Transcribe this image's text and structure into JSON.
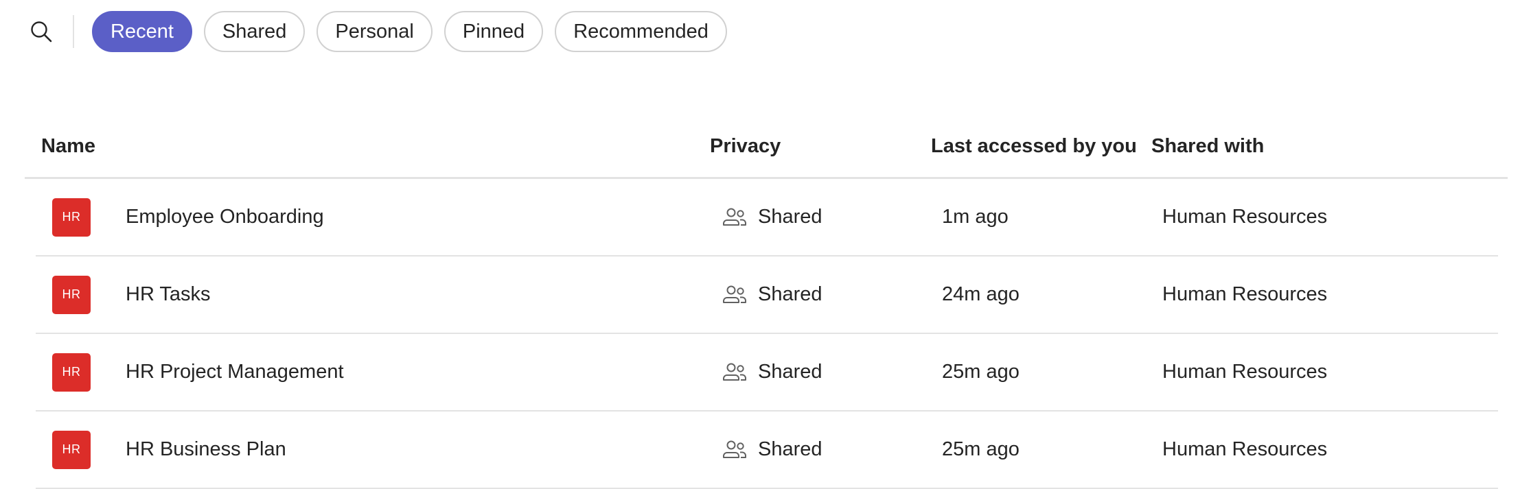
{
  "filters": {
    "search_icon": "search-icon",
    "chips": [
      {
        "label": "Recent",
        "active": true
      },
      {
        "label": "Shared",
        "active": false
      },
      {
        "label": "Personal",
        "active": false
      },
      {
        "label": "Pinned",
        "active": false
      },
      {
        "label": "Recommended",
        "active": false
      }
    ]
  },
  "table": {
    "headers": {
      "name": "Name",
      "privacy": "Privacy",
      "last_accessed": "Last accessed by you",
      "shared_with": "Shared with"
    },
    "rows": [
      {
        "avatar": "HR",
        "name": "Employee Onboarding",
        "privacy": "Shared",
        "last_accessed": "1m ago",
        "shared_with": "Human Resources"
      },
      {
        "avatar": "HR",
        "name": "HR Tasks",
        "privacy": "Shared",
        "last_accessed": "24m ago",
        "shared_with": "Human Resources"
      },
      {
        "avatar": "HR",
        "name": "HR Project Management",
        "privacy": "Shared",
        "last_accessed": "25m ago",
        "shared_with": "Human Resources"
      },
      {
        "avatar": "HR",
        "name": "HR Business Plan",
        "privacy": "Shared",
        "last_accessed": "25m ago",
        "shared_with": "Human Resources"
      }
    ],
    "privacy_icon": "people-icon"
  },
  "colors": {
    "accent": "#5b5fc7",
    "avatar_bg": "#dc2d29",
    "divider": "#e3e3e3",
    "text": "#242424"
  }
}
